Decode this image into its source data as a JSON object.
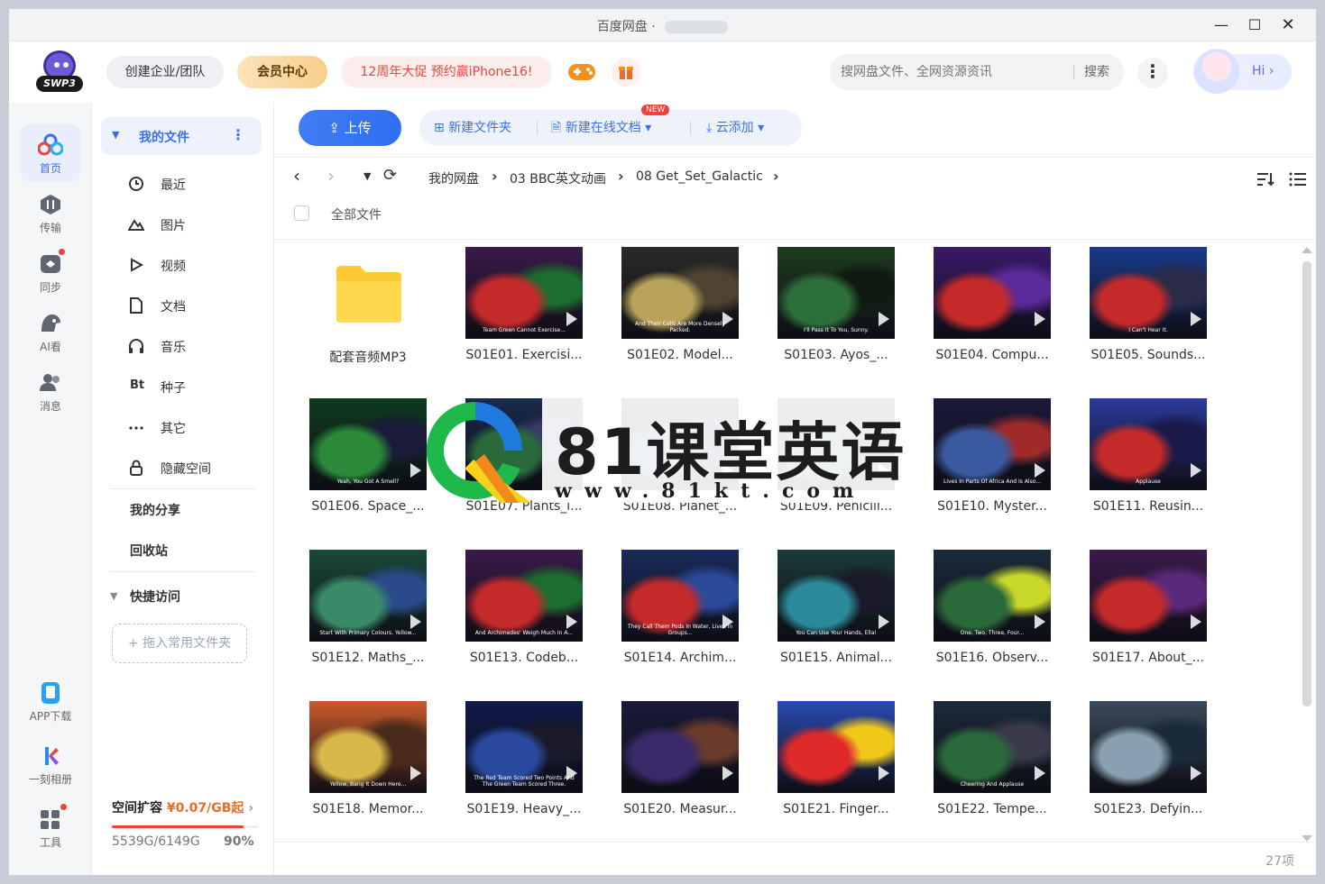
{
  "window": {
    "title": "百度网盘",
    "controls": {
      "minimize": "—",
      "maximize": "☐",
      "close": "✕"
    }
  },
  "header": {
    "logo_text": "SWP3",
    "team_label": "创建企业/团队",
    "vip_label": "会员中心",
    "promo_label": "12周年大促 预约赢iPhone16!",
    "search_placeholder": "搜网盘文件、全网资源资讯",
    "search_button": "搜索",
    "more_label": "⋮",
    "hi_label": "Hi ›"
  },
  "rail": {
    "items": [
      {
        "label": "首页",
        "icon": "home-cloud-icon",
        "active": true
      },
      {
        "label": "传输",
        "icon": "transfer-icon"
      },
      {
        "label": "同步",
        "icon": "sync-icon",
        "dot": true
      },
      {
        "label": "AI看",
        "icon": "ai-view-icon"
      },
      {
        "label": "消息",
        "icon": "message-icon"
      }
    ],
    "bottom": [
      {
        "label": "APP下载",
        "icon": "phone-icon"
      },
      {
        "label": "一刻相册",
        "icon": "album-icon"
      },
      {
        "label": "工具",
        "icon": "tools-icon",
        "dot": true
      }
    ]
  },
  "sidebar": {
    "my_files": "我的文件",
    "items": [
      {
        "label": "最近",
        "icon": "clock-icon"
      },
      {
        "label": "图片",
        "icon": "image-icon"
      },
      {
        "label": "视频",
        "icon": "video-icon"
      },
      {
        "label": "文档",
        "icon": "document-icon"
      },
      {
        "label": "音乐",
        "icon": "headphones-icon"
      },
      {
        "label": "种子",
        "icon": "torrent-icon",
        "glyph": "Bt"
      },
      {
        "label": "其它",
        "icon": "more-dots-icon"
      },
      {
        "label": "隐藏空间",
        "icon": "lock-icon"
      }
    ],
    "my_share": "我的分享",
    "recycle": "回收站",
    "quick_access": "快捷访问",
    "drop_hint": "+ 拖入常用文件夹",
    "quota": {
      "label": "空间扩容",
      "price": "¥0.07/GB起",
      "arrow": "›",
      "used": "5539G/6149G",
      "percent": "90%",
      "fraction": 0.9
    }
  },
  "toolbar": {
    "upload": "上传",
    "new_folder": "新建文件夹",
    "new_doc": "新建在线文档",
    "new_badge": "NEW",
    "cloud_add": "云添加"
  },
  "breadcrumb": {
    "items": [
      "我的网盘",
      "03 BBC英文动画",
      "08 Get_Set_Galactic"
    ]
  },
  "list": {
    "select_all": "全部文件",
    "count": "27项"
  },
  "files": [
    {
      "name": "配套音频MP3",
      "type": "folder"
    },
    {
      "name": "S01E01. Exercisi...",
      "type": "video",
      "subtitle": "Team Green Cannot Exercise...",
      "colors": [
        "#3a1a4a",
        "#c42a2a",
        "#1b6e2f"
      ]
    },
    {
      "name": "S01E02. Model...",
      "type": "video",
      "subtitle": "And Their Cells Are More Densely Packed.",
      "colors": [
        "#2a2a2a",
        "#b9a35a",
        "#4d4330"
      ]
    },
    {
      "name": "S01E03. Ayos_...",
      "type": "video",
      "subtitle": "I'll Pass It To You, Sunny.",
      "colors": [
        "#1f3b1f",
        "#2d6f3a",
        "#0f1a10"
      ]
    },
    {
      "name": "S01E04. Compu...",
      "type": "video",
      "subtitle": "",
      "colors": [
        "#3a1a6a",
        "#c42a2a",
        "#5a2a9a"
      ]
    },
    {
      "name": "S01E05. Sounds...",
      "type": "video",
      "subtitle": "I Can't Hear It.",
      "colors": [
        "#1a3a8a",
        "#c42a2a",
        "#2b2b4a"
      ]
    },
    {
      "name": "S01E06. Space_...",
      "type": "video",
      "subtitle": "Yeah, You Got A Smell?",
      "colors": [
        "#0f3a1f",
        "#2a8a3a",
        "#1a1a3a"
      ]
    },
    {
      "name": "S01E07. Plants_i...",
      "type": "video",
      "subtitle": "",
      "colors": [
        "#1a2a4a",
        "#2a6a3a",
        "#3a3a6a"
      ]
    },
    {
      "name": "S01E08. Planet_...",
      "type": "video",
      "subtitle": "",
      "colors": [
        "#1a1a3a",
        "#2a4a8a",
        "#3a1a5a"
      ]
    },
    {
      "name": "S01E09. Penicill...",
      "type": "video",
      "subtitle": "",
      "colors": [
        "#1a2a1a",
        "#3a6a3a",
        "#2a2a2a"
      ]
    },
    {
      "name": "S01E10. Myster...",
      "type": "video",
      "subtitle": "Lives In Parts Of Africa And Is Also...",
      "colors": [
        "#1a1a3a",
        "#3a5aa0",
        "#a02a2a"
      ]
    },
    {
      "name": "S01E11. Reusin...",
      "type": "video",
      "subtitle": "Applause",
      "colors": [
        "#2a3a9a",
        "#c42a2a",
        "#1a1a4a"
      ]
    },
    {
      "name": "S01E12. Maths_...",
      "type": "video",
      "subtitle": "Start With Primary Colours, Yellow...",
      "colors": [
        "#1a4a3a",
        "#3a8a6a",
        "#2a4a8a"
      ]
    },
    {
      "name": "S01E13. Codeb...",
      "type": "video",
      "subtitle": "And Archimedes' Weigh Much In A...",
      "colors": [
        "#3a1a4a",
        "#c42a2a",
        "#1b6e2f"
      ]
    },
    {
      "name": "S01E14. Archim...",
      "type": "video",
      "subtitle": "They Call Them Pods In Water, Lives In Groups...",
      "colors": [
        "#1a2a5a",
        "#c42a2a",
        "#2a4a9a"
      ]
    },
    {
      "name": "S01E15. Animal...",
      "type": "video",
      "subtitle": "You Can Use Your Hands, Ella!",
      "colors": [
        "#1a3a3a",
        "#2a8a9a",
        "#1a1a2a"
      ]
    },
    {
      "name": "S01E16. Observ...",
      "type": "video",
      "subtitle": "One, Two, Three, Four...",
      "colors": [
        "#1a2a3a",
        "#2a6a3a",
        "#c8d82a"
      ]
    },
    {
      "name": "S01E17. About_...",
      "type": "video",
      "subtitle": "",
      "colors": [
        "#3a1a4a",
        "#c42a2a",
        "#5a2a7a"
      ]
    },
    {
      "name": "S01E18. Memor...",
      "type": "video",
      "subtitle": "Yellow, Bang It Down Here...",
      "colors": [
        "#c85a2a",
        "#d8b84a",
        "#4a2a1a"
      ]
    },
    {
      "name": "S01E19. Heavy_...",
      "type": "video",
      "subtitle": "The Red Team Scored Two Points And The Green Team Scored Three.",
      "colors": [
        "#0f1a4a",
        "#2a4aa0",
        "#1a1a2a"
      ]
    },
    {
      "name": "S01E20. Measur...",
      "type": "video",
      "subtitle": "",
      "colors": [
        "#1a1a3a",
        "#3a2a6a",
        "#6a3a2a"
      ]
    },
    {
      "name": "S01E21. Finger...",
      "type": "video",
      "subtitle": "",
      "colors": [
        "#2a4ab0",
        "#e02a2a",
        "#f0c81a"
      ]
    },
    {
      "name": "S01E22. Tempe...",
      "type": "video",
      "subtitle": "Cheering And Applause",
      "colors": [
        "#1a2a3a",
        "#2a6a3a",
        "#3a3a4a"
      ]
    },
    {
      "name": "S01E23. Defyin...",
      "type": "video",
      "subtitle": "",
      "colors": [
        "#3a4a5a",
        "#8aa0b0",
        "#1a2a3a"
      ]
    }
  ],
  "watermark": {
    "title": "81课堂英语",
    "url": "www.81kt.com"
  },
  "colors": {
    "accent": "#3c6ef0",
    "promo": "#e8473b",
    "quota_price": "#f06a2a",
    "folder": "#ffc933"
  }
}
